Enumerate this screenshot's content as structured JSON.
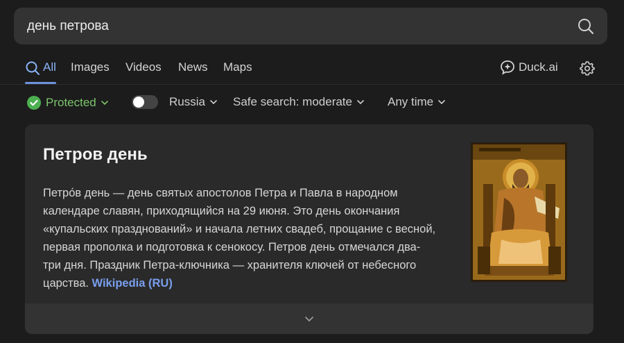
{
  "search": {
    "query": "день петрова"
  },
  "tabs": [
    {
      "label": "All"
    },
    {
      "label": "Images"
    },
    {
      "label": "Videos"
    },
    {
      "label": "News"
    },
    {
      "label": "Maps"
    }
  ],
  "header": {
    "duckai_label": "Duck.ai"
  },
  "filters": {
    "protected_label": "Protected",
    "region_label": "Russia",
    "safe_search_label": "Safe search: moderate",
    "time_label": "Any time"
  },
  "card": {
    "title": "Петров день",
    "text": "Петро́в день — день святых апостолов Петра и Павла в народном календаре славян, приходящийся на 29 июня. Это день окончания «купальских празднований» и начала летних свадеб, прощание с весной, первая прополка и подготовка к сенокосу. Петров день отмечался два-три дня. Праздник Петра-ключника — хранителя ключей от небесного царства.",
    "link_label": "Wikipedia (RU)"
  },
  "colors": {
    "accent": "#8ab4f8",
    "protected": "#7cc46b",
    "background": "#1c1c1c",
    "card": "#2a2a2a"
  },
  "icons": [
    "search-icon",
    "duckai-icon",
    "gear-icon",
    "shield-check-icon",
    "chevron-down-icon"
  ]
}
